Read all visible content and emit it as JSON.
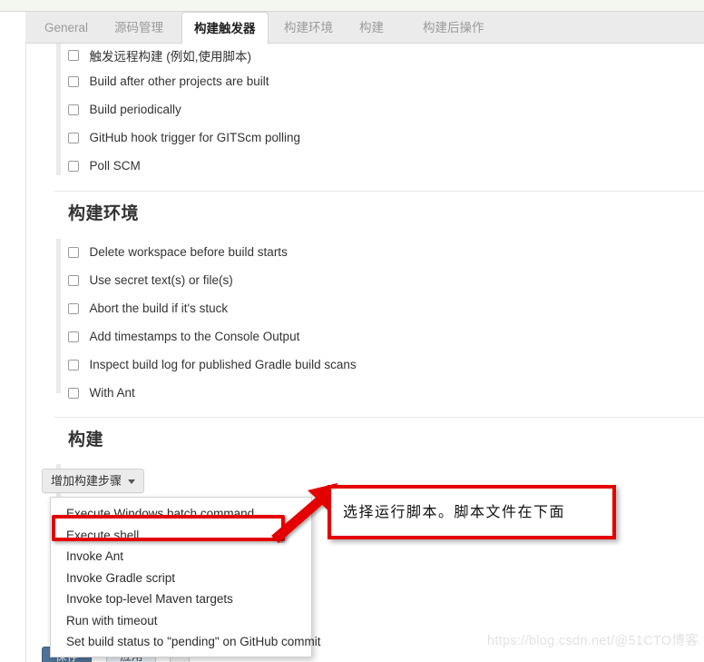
{
  "app": {
    "watermark": "https://blog.csdn.net/@51CTO博客"
  },
  "tabs": [
    {
      "label": "General",
      "active": false
    },
    {
      "label": "源码管理",
      "active": false
    },
    {
      "label": "构建触发器",
      "active": true
    },
    {
      "label": "构建环境",
      "active": false
    },
    {
      "label": "构建",
      "active": false
    },
    {
      "label": "构建后操作",
      "active": false
    }
  ],
  "sections": [
    {
      "id": "build-triggers",
      "title": "",
      "checkboxes": [
        {
          "label": "触发远程构建 (例如,使用脚本)",
          "checked": false
        },
        {
          "label": "Build after other projects are built",
          "checked": false
        },
        {
          "label": "Build periodically",
          "checked": false
        },
        {
          "label": "GitHub hook trigger for GITScm polling",
          "checked": false
        },
        {
          "label": "Poll SCM",
          "checked": false
        }
      ]
    },
    {
      "id": "build-environment",
      "title": "构建环境",
      "checkboxes": [
        {
          "label": "Delete workspace before build starts",
          "checked": false
        },
        {
          "label": "Use secret text(s) or file(s)",
          "checked": false
        },
        {
          "label": "Abort the build if it's stuck",
          "checked": false
        },
        {
          "label": "Add timestamps to the Console Output",
          "checked": false
        },
        {
          "label": "Inspect build log for published Gradle build scans",
          "checked": false
        },
        {
          "label": "With Ant",
          "checked": false
        }
      ]
    },
    {
      "id": "build",
      "title": "构建",
      "checkboxes": []
    }
  ],
  "build_section": {
    "add_step_label": "增加构建步骤",
    "caret_icon": "chevron-down-icon",
    "menu_items": [
      "Execute Windows batch command",
      "Execute shell",
      "Invoke Ant",
      "Invoke Gradle script",
      "Invoke top-level Maven targets",
      "Run with timeout",
      "Set build status to \"pending\" on GitHub commit"
    ]
  },
  "bottom_actions": {
    "save_label": "保存",
    "apply_label": "应用",
    "extra_label": ""
  },
  "annotation": {
    "callout_text": "选择运行脚本。脚本文件在下面",
    "highlighted_item": "Execute shell",
    "color": "#e50000"
  }
}
